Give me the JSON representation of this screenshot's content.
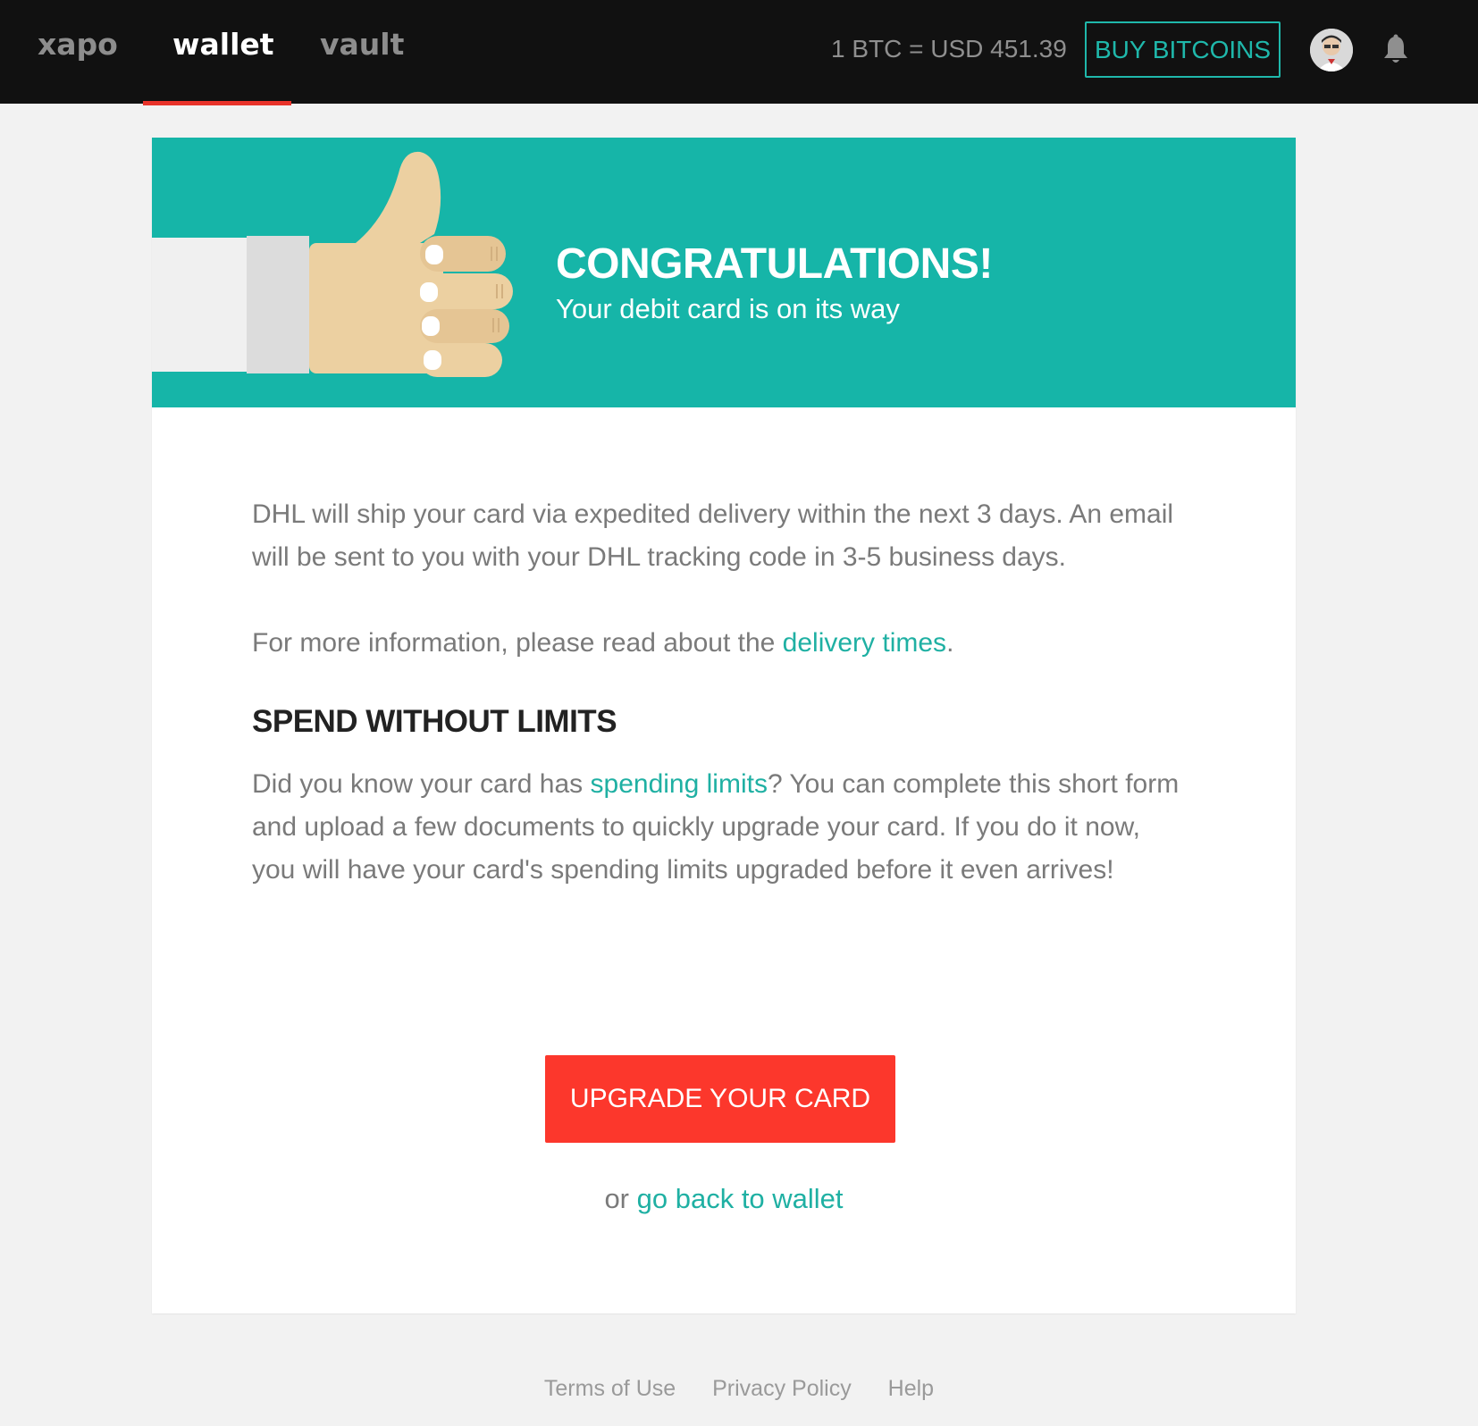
{
  "nav": {
    "brand": "xapo",
    "tabs": [
      {
        "label": "wallet",
        "active": true
      },
      {
        "label": "vault",
        "active": false
      }
    ],
    "rate": "1 BTC = USD 451.39",
    "buy_button": "BUY BITCOINS",
    "icons": [
      "avatar",
      "bell-icon"
    ]
  },
  "banner": {
    "title": "CONGRATULATIONS!",
    "subtitle": "Your debit card is on its way",
    "background_color": "#16b5a8"
  },
  "content": {
    "p1": "DHL will ship your card via expedited delivery within the next 3 days. An email will be sent to you with your DHL tracking code in 3-5 business days.",
    "p2_prefix": "For more information, please read about the ",
    "p2_link": "delivery times",
    "p2_suffix": ".",
    "heading": "SPEND WITHOUT LIMITS",
    "p3_prefix": "Did you know your card has ",
    "p3_link": "spending limits",
    "p3_suffix": "? You can complete this short form and upload a few documents to quickly upgrade your card. If you do it now, you will have your card's spending limits upgraded before it even arrives!",
    "upgrade_button": "UPGRADE YOUR CARD",
    "back_prefix": "or ",
    "back_link": "go back to wallet"
  },
  "footer": {
    "links": [
      "Terms of Use",
      "Privacy Policy",
      "Help"
    ]
  },
  "colors": {
    "accent": "#1fb0a3",
    "danger": "#fc372c",
    "nav_bg": "#111111",
    "active_underline": "#e8332a"
  }
}
